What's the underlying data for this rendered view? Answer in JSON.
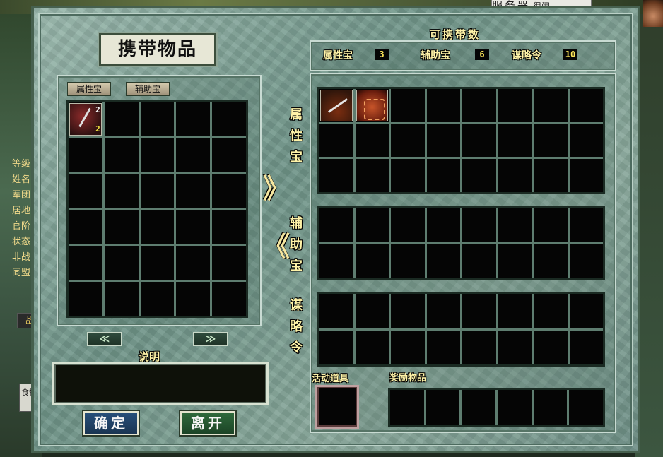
{
  "server": {
    "label": "服务器",
    "tail": "很闹"
  },
  "side": {
    "labels": [
      "等级",
      "姓名",
      "军团",
      "居地",
      "官阶",
      "状态",
      "非战",
      "同盟"
    ],
    "battle": "战",
    "food": "食物"
  },
  "left": {
    "title": "携带物品",
    "tabs": [
      "属性宝",
      "辅助宝"
    ],
    "rows": 6,
    "cols": 5,
    "items": [
      {
        "name": "spear-item-icon",
        "qty_top": "2",
        "qty_bottom": "2"
      }
    ],
    "prev_label": "≪",
    "next_label": "≫"
  },
  "description": {
    "label": "说明",
    "text": ""
  },
  "buttons": {
    "confirm": "确定",
    "leave": "离开"
  },
  "right": {
    "header": "可携带数",
    "caps": [
      {
        "label": "属性宝",
        "value": "3"
      },
      {
        "label": "辅助宝",
        "value": "6"
      },
      {
        "label": "谋略令",
        "value": "10"
      }
    ],
    "sections": [
      {
        "label": "属性宝",
        "chars": [
          "属",
          "性",
          "宝"
        ],
        "rows": 3,
        "cols": 8,
        "items": [
          {
            "name": "sword-item-icon"
          },
          {
            "name": "armor-item-icon"
          }
        ]
      },
      {
        "label": "辅助宝",
        "chars": [
          "辅",
          "助",
          "宝"
        ],
        "rows": 2,
        "cols": 8,
        "items": []
      },
      {
        "label": "谋略令",
        "chars": [
          "谋",
          "略",
          "令"
        ],
        "rows": 2,
        "cols": 8,
        "items": []
      }
    ],
    "to_right_arrow": "》",
    "to_left_arrow": "《",
    "event_label": "活动道具",
    "reward_label": "奖励物品",
    "reward_cols": 6
  }
}
